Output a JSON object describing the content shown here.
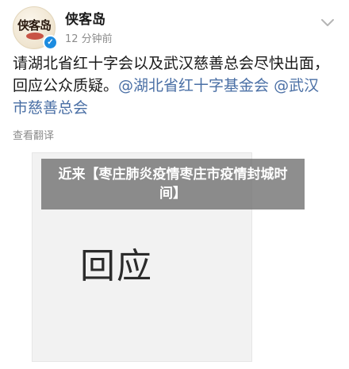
{
  "header": {
    "avatar_text": "侠客岛",
    "username": "侠客岛",
    "timestamp": "12 分钟前"
  },
  "post": {
    "text_plain": "请湖北省红十字会以及武汉慈善总会尽快出面，回应公众质疑。",
    "mention_1": "@湖北省红十字基金会",
    "mention_2": "@武汉市慈善总会",
    "translate_label": "查看翻译"
  },
  "image": {
    "title": "回应"
  },
  "banner": {
    "text": "近来【枣庄肺炎疫情枣庄市疫情封城时间】"
  },
  "colors": {
    "mention": "#4a6fa5",
    "verified": "#1d8ce0"
  },
  "icons": {
    "verified": "verified-badge-icon",
    "menu": "chevron-down-icon"
  }
}
